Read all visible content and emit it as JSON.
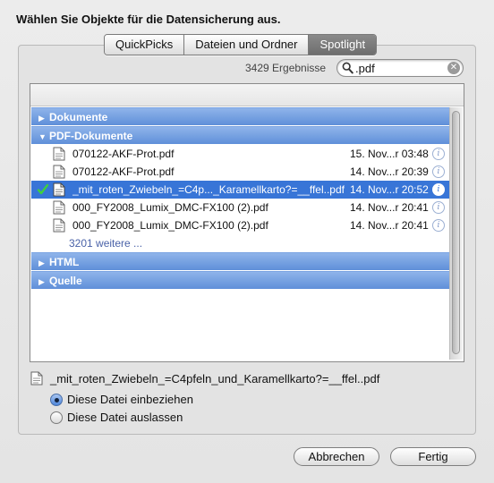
{
  "dialog": {
    "title": "Wählen Sie Objekte für die Datensicherung aus."
  },
  "tabs": [
    {
      "label": "QuickPicks",
      "active": false
    },
    {
      "label": "Dateien und Ordner",
      "active": false
    },
    {
      "label": "Spotlight",
      "active": true
    }
  ],
  "search": {
    "results_count": "3429 Ergebnisse",
    "query": ".pdf"
  },
  "groups": {
    "dokumente": "Dokumente",
    "pdf": "PDF-Dokumente",
    "html": "HTML",
    "quelle": "Quelle"
  },
  "files": [
    {
      "name": "070122-AKF-Prot.pdf",
      "date": "15. Nov...r 03:48",
      "selected": false,
      "checked": false
    },
    {
      "name": "070122-AKF-Prot.pdf",
      "date": "14. Nov...r 20:39",
      "selected": false,
      "checked": false
    },
    {
      "name": "_mit_roten_Zwiebeln_=C4p..._Karamellkarto?=__ffel..pdf",
      "date": "14. Nov...r 20:52",
      "selected": true,
      "checked": true
    },
    {
      "name": "000_FY2008_Lumix_DMC-FX100 (2).pdf",
      "date": "14. Nov...r 20:41",
      "selected": false,
      "checked": false
    },
    {
      "name": "000_FY2008_Lumix_DMC-FX100 (2).pdf",
      "date": "14. Nov...r 20:41",
      "selected": false,
      "checked": false
    }
  ],
  "more_label": "3201 weitere ...",
  "selected_file": {
    "name": "_mit_roten_Zwiebeln_=C4pfeln_und_Karamellkarto?=__ffel..pdf"
  },
  "options": {
    "include": "Diese Datei einbeziehen",
    "exclude": "Diese Datei auslassen",
    "chosen": "include"
  },
  "buttons": {
    "cancel": "Abbrechen",
    "done": "Fertig"
  },
  "colors": {
    "selection": "#3875d7",
    "group_header": "#6f9ce0",
    "check": "#2fa52f"
  },
  "icons": {
    "search": "magnifier-icon",
    "clear": "clear-search-icon",
    "file": "pdf-document-icon",
    "info": "info-icon",
    "check": "checkmark-icon"
  }
}
